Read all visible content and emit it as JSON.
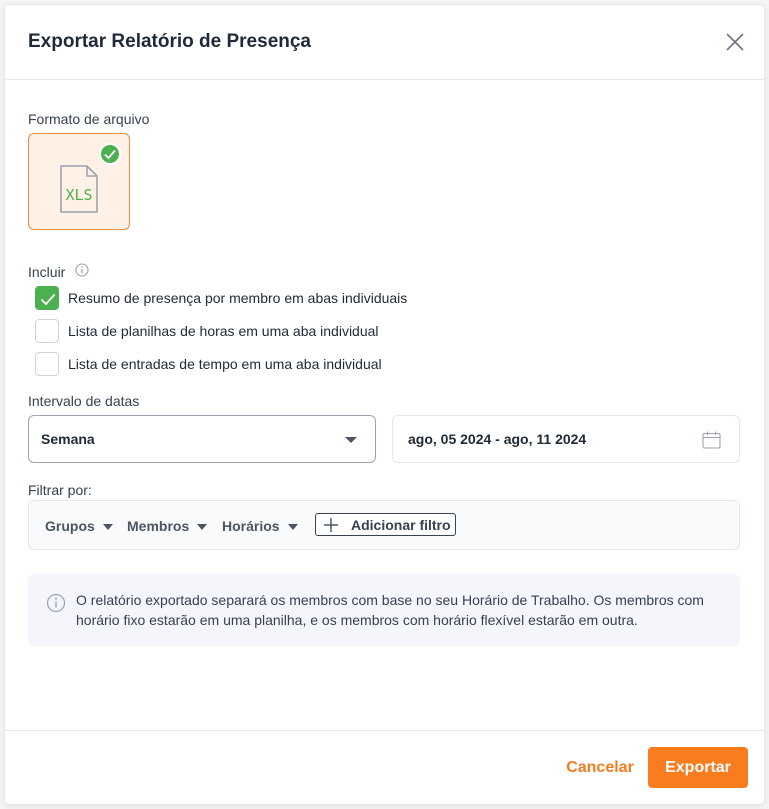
{
  "dialog": {
    "title": "Exportar Relatório de Presença"
  },
  "file_format": {
    "label": "Formato de arquivo",
    "option": {
      "text": "XLS",
      "selected": true,
      "icon": "xls-file-icon"
    }
  },
  "include": {
    "label": "Incluir",
    "options": [
      {
        "label": "Resumo de presença por membro em abas individuais",
        "checked": true
      },
      {
        "label": "Lista de planilhas de horas em uma aba individual",
        "checked": false
      },
      {
        "label": "Lista de entradas de tempo em uma aba individual",
        "checked": false
      }
    ]
  },
  "date_range": {
    "label": "Intervalo de datas",
    "period": "Semana",
    "range": "ago, 05 2024 - ago, 11 2024"
  },
  "filter": {
    "label": "Filtrar por:",
    "dropdowns": [
      "Grupos",
      "Membros",
      "Horários"
    ],
    "add_label": "Adicionar filtro"
  },
  "notice": {
    "text": "O relatório exportado separará os membros com base no seu Horário de Trabalho. Os membros com horário fixo estarão em uma planilha, e os membros com horário flexível estarão em outra."
  },
  "actions": {
    "cancel": "Cancelar",
    "export": "Exportar"
  },
  "colors": {
    "accent": "#f97d1f",
    "success": "#4caf50",
    "xls_green": "#4caf50"
  }
}
